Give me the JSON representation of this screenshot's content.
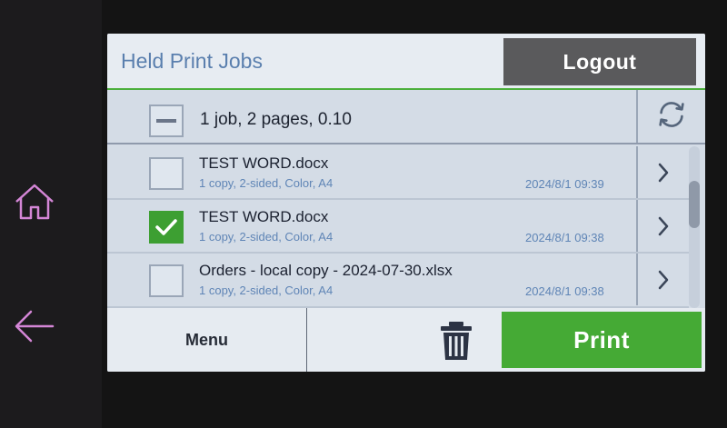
{
  "header": {
    "title": "Held Print Jobs",
    "logout_label": "Logout"
  },
  "summary": {
    "text": "1 job, 2 pages, 0.10",
    "select_all_state": "indeterminate",
    "refresh_icon": "refresh-icon"
  },
  "jobs": [
    {
      "name": "TEST WORD.docx",
      "details": "1 copy, 2-sided, Color, A4",
      "date": "2024/8/1 09:39",
      "checked": false
    },
    {
      "name": "TEST WORD.docx",
      "details": "1 copy, 2-sided, Color, A4",
      "date": "2024/8/1 09:38",
      "checked": true
    },
    {
      "name": "Orders - local copy - 2024-07-30.xlsx",
      "details": "1 copy, 2-sided, Color, A4",
      "date": "2024/8/1 09:38",
      "checked": false
    }
  ],
  "footer": {
    "menu_label": "Menu",
    "print_label": "Print",
    "delete_icon": "trash-icon"
  },
  "hardware": {
    "home_icon": "home-icon",
    "back_icon": "back-arrow-icon"
  },
  "colors": {
    "accent_green": "#45aa35",
    "title_blue": "#5a7fae",
    "logout_gray": "#5a5a5c",
    "hw_icon_pink": "#d486d6"
  }
}
